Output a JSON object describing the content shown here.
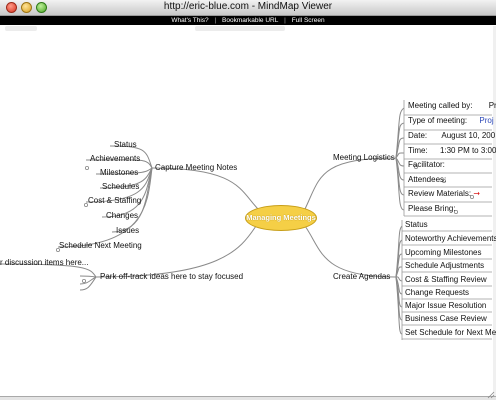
{
  "window": {
    "title": "http://eric-blue.com - MindMap Viewer",
    "links": [
      "What's This?",
      "Bookmarkable URL",
      "Full Screen"
    ],
    "separator": "|"
  },
  "mindmap": {
    "center": "Managing Meetings",
    "capture": {
      "label": "Capture Meeting Notes",
      "children": [
        "Status",
        "Achievements",
        "Milestones",
        "Schedules",
        "Cost & Staffing",
        "Changes",
        "Issues",
        "Schedule Next Meeting"
      ]
    },
    "park": {
      "label": "Park off-track ideas here to stay focused",
      "child": "r discussion items here..."
    },
    "logistics": {
      "label": "Meeting Logistics",
      "rows": [
        {
          "label": "Meeting called by:",
          "value": "Pr"
        },
        {
          "label": "Type of meeting:",
          "value": "Proj"
        },
        {
          "label": "Date:",
          "value": "August 10, 200"
        },
        {
          "label": "Time:",
          "value": "1:30 PM to 3:00"
        },
        {
          "label": "Facilitator:",
          "value": ""
        },
        {
          "label": "Attendees:",
          "value": ""
        },
        {
          "label": "Review Materials:",
          "value": "➞"
        },
        {
          "label": "Please Bring:",
          "value": ""
        }
      ]
    },
    "agendas": {
      "label": "Create Agendas",
      "items": [
        "Status",
        "Noteworthy Achievements",
        "Upcoming Milestones",
        "Schedule Adjustments",
        "Cost & Staffing Review",
        "Change Requests",
        "Major Issue Resolution",
        "Business Case Review",
        "Set Schedule for Next Mee"
      ]
    }
  }
}
